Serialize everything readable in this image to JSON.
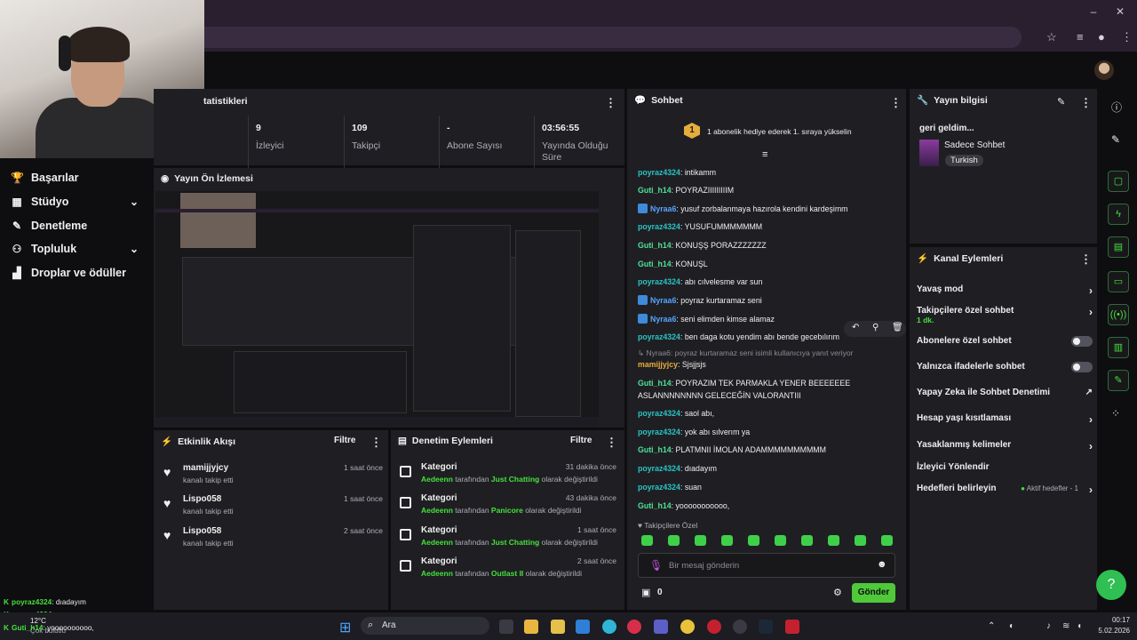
{
  "nav": {
    "items": [
      {
        "label": "Başarılar",
        "icon": "trophy-icon"
      },
      {
        "label": "Stüdyo",
        "icon": "studio-icon",
        "chevron": true
      },
      {
        "label": "Denetleme",
        "icon": "wrench-icon"
      },
      {
        "label": "Topluluk",
        "icon": "community-icon",
        "chevron": true
      },
      {
        "label": "Droplar ve ödüller",
        "icon": "drops-icon"
      }
    ]
  },
  "stats": {
    "title": "tatistikleri",
    "cells": [
      {
        "value": "9",
        "label": "İzleyici"
      },
      {
        "value": "109",
        "label": "Takipçi"
      },
      {
        "value": "-",
        "label": "Abone Sayısı"
      },
      {
        "value": "03:56:55",
        "label": "Yayında Olduğu Süre"
      }
    ]
  },
  "preview": {
    "title": "Yayın Ön İzlemesi"
  },
  "activity": {
    "title": "Etkinlik Akışı",
    "filter": "Filtre",
    "rows": [
      {
        "name": "mamijjyjcy",
        "sub": "kanalı takip etti",
        "time": "1 saat önce"
      },
      {
        "name": "Lispo058",
        "sub": "kanalı takip etti",
        "time": "1 saat önce"
      },
      {
        "name": "Lispo058",
        "sub": "kanalı takip etti",
        "time": "2 saat önce"
      }
    ]
  },
  "modactions": {
    "title": "Denetim Eylemleri",
    "filter": "Filtre",
    "rows": [
      {
        "title": "Kategori",
        "user": "Aedeenn",
        "mid": " tarafından ",
        "cat": "Just Chatting",
        "end": " olarak değiştirildi",
        "time": "31 dakika önce"
      },
      {
        "title": "Kategori",
        "user": "Aedeenn",
        "mid": " tarafından ",
        "cat": "Panicore",
        "end": " olarak değiştirildi",
        "time": "43 dakika önce"
      },
      {
        "title": "Kategori",
        "user": "Aedeenn",
        "mid": " tarafından ",
        "cat": "Just Chatting",
        "end": " olarak değiştirildi",
        "time": "1 saat önce"
      },
      {
        "title": "Kategori",
        "user": "Aedeenn",
        "mid": " tarafından ",
        "cat": "Outlast II",
        "end": " olarak değiştirildi",
        "time": "2 saat önce"
      }
    ]
  },
  "chat": {
    "title": "Sohbet",
    "hype": {
      "level": "1",
      "text": "1 abonelik hediye ederek 1. sıraya yükselin"
    },
    "messages": [
      {
        "user": "poyraz4324",
        "color": "p",
        "text": ": intikamm"
      },
      {
        "user": "Guti_h14",
        "color": "g",
        "text": ": POYRAZIIIIIIIIIM"
      },
      {
        "user": "Nyraa6",
        "color": "n",
        "badge": true,
        "text": ": yusuf zorbalanmaya hazırola kendini kardeşimm"
      },
      {
        "user": "poyraz4324",
        "color": "p",
        "text": ": YUSUFUMMMMMMM"
      },
      {
        "user": "Guti_h14",
        "color": "g",
        "text": ": KONUŞŞ PORAZZZZZZZ"
      },
      {
        "user": "Guti_h14",
        "color": "g",
        "text": ": KONUŞL"
      },
      {
        "user": "poyraz4324",
        "color": "p",
        "text": ": abı cılvelesme var sun"
      },
      {
        "user": "Nyraa6",
        "color": "n",
        "badge": true,
        "text": ": poyraz kurtaramaz seni"
      },
      {
        "user": "Nyraa6",
        "color": "n",
        "badge": true,
        "text": ": seni elimden kimse alamaz"
      },
      {
        "user": "poyraz4324",
        "color": "p",
        "text": ": ben daga kotu yendim abı bende gecebılırım"
      }
    ],
    "reply_hint": "Nyraa6: poyraz kurtaramaz seni isimli kullanıcıya yanıt veriyor",
    "messages2": [
      {
        "user": "mamijjyjcy",
        "color": "m",
        "text": ": Sjsjjsjs"
      },
      {
        "user": "Guti_h14",
        "color": "g",
        "text": ": POYRAZIM TEK PARMAKLA YENER BEEEEEEE ASLANNNNNNNN GELECEĞİN VALORANTIII"
      },
      {
        "user": "poyraz4324",
        "color": "p",
        "text": ": saol abı,"
      },
      {
        "user": "poyraz4324",
        "color": "p",
        "text": ": yok abı sılverım ya"
      },
      {
        "user": "Guti_h14",
        "color": "g",
        "text": ": PLATMNII İMOLAN ADAMMMMMMMMMM"
      },
      {
        "user": "poyraz4324",
        "color": "p",
        "text": ": dıadayım"
      },
      {
        "user": "poyraz4324",
        "color": "p",
        "text": ": suan"
      },
      {
        "user": "Guti_h14",
        "color": "g",
        "text": ": yooooooooooo,"
      }
    ],
    "emote_label": "Takipçilere Özel",
    "input_placeholder": "Bir mesaj gönderin",
    "points": "0",
    "send": "Gönder"
  },
  "streaminfo": {
    "title": "Yayın bilgisi",
    "stream_title": "geri geldim...",
    "category": "Sadece Sohbet",
    "tag": "Turkish"
  },
  "channel": {
    "title": "Kanal Eylemleri",
    "rows": [
      {
        "label": "Yavaş mod",
        "kind": "chev"
      },
      {
        "label": "Takipçilere özel sohbet",
        "sub": "1 dk.",
        "kind": "chev"
      },
      {
        "label": "Abonelere özel sohbet",
        "kind": "toggle"
      },
      {
        "label": "Yalnızca ifadelerle sohbet",
        "kind": "toggle"
      },
      {
        "label": "Yapay Zeka ile Sohbet Denetimi",
        "kind": "ext"
      },
      {
        "label": "Hesap yaşı kısıtlaması",
        "kind": "chev"
      },
      {
        "label": "Yasaklanmış kelimeler",
        "kind": "chev"
      },
      {
        "label": "İzleyici Yönlendir",
        "kind": "none"
      },
      {
        "label": "Hedefleri belirleyin",
        "kind": "chev",
        "note": "Aktif hedefler - 1"
      }
    ]
  },
  "overlay_chat": [
    {
      "user": "poyraz4324",
      "text": "dıadayım"
    },
    {
      "user": "poyraz4324",
      "text": "suan"
    },
    {
      "user": "Guti_h14",
      "text": "yoooooooooo,"
    }
  ],
  "taskbar": {
    "search": "Ara",
    "weather": "12°C",
    "weather_sub": "Çok bulutlu",
    "time": "00:17",
    "date": "5.02.2026"
  }
}
